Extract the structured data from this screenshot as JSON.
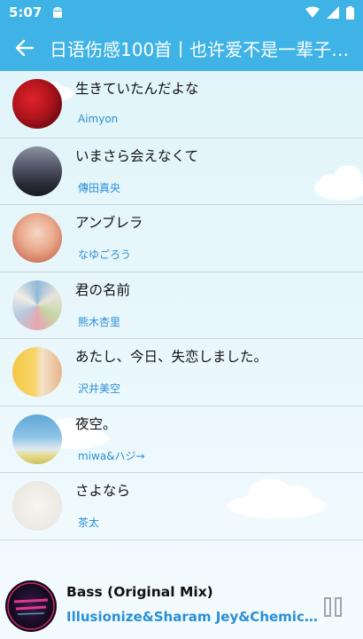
{
  "status_bar": {
    "time": "5:07"
  },
  "app_bar": {
    "title": "日语伤感100首丨也许爱不是一辈子…"
  },
  "songs": [
    {
      "title": "生きていたんだよな",
      "artist": "Aimyon"
    },
    {
      "title": "いまさら会えなくて",
      "artist": "傳田真央"
    },
    {
      "title": "アンブレラ",
      "artist": "なゆごろう"
    },
    {
      "title": "君の名前",
      "artist": "熊木杏里"
    },
    {
      "title": "あたし、今日、失恋しました。",
      "artist": "沢井美空"
    },
    {
      "title": "夜空。",
      "artist": "miwa&ハジ→"
    },
    {
      "title": "さよなら",
      "artist": "茶太"
    }
  ],
  "player": {
    "title": "Bass (Original Mix)",
    "artist": "Illusionize&Sharam Jey&Chemic…"
  },
  "colors": {
    "accent": "#3fb3e6",
    "artist_text": "#2a8fd8"
  }
}
